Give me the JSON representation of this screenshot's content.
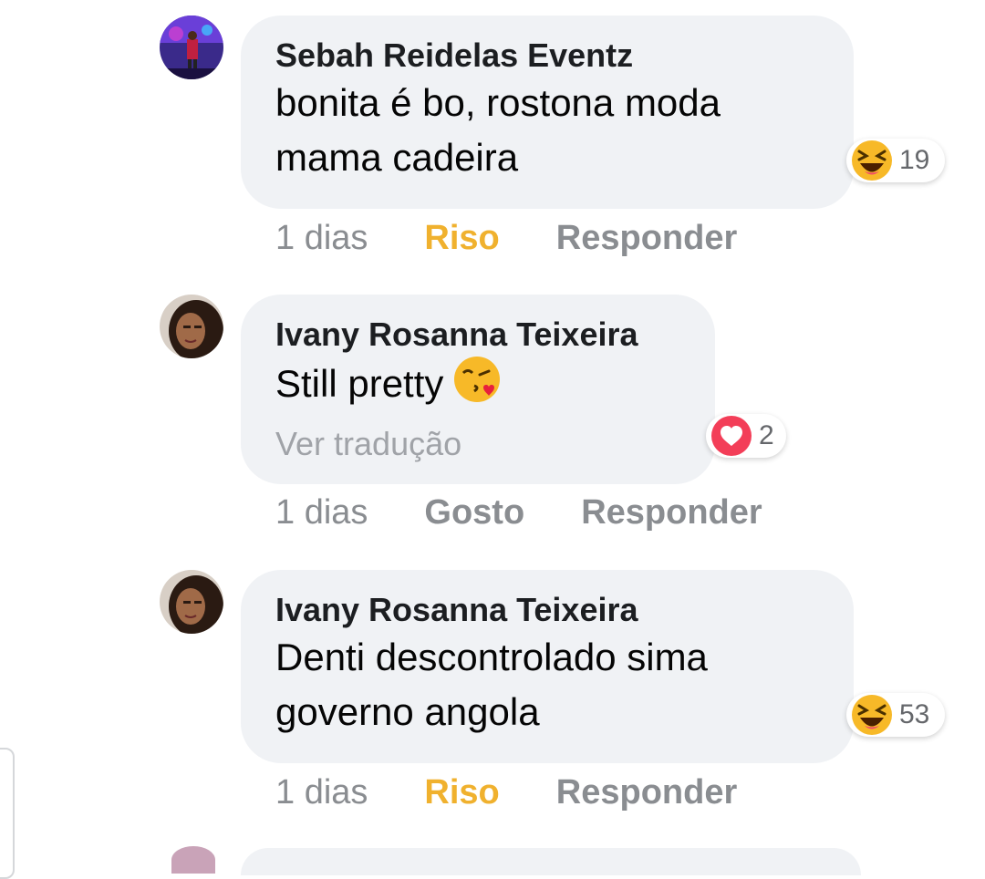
{
  "comments": [
    {
      "author": "Sebah Reidelas Eventz",
      "text": "bonita é bo, rostona moda mama cadeira",
      "translate": "",
      "reaction": {
        "icon": "laughing-emoji",
        "count": "19"
      },
      "actions": {
        "time": "1 dias",
        "react": "Riso",
        "reply": "Responder"
      }
    },
    {
      "author": "Ivany Rosanna Teixeira",
      "text": "Still pretty",
      "inline_emoji": "kiss-emoji",
      "translate": "Ver tradução",
      "reaction": {
        "icon": "heart",
        "count": "2"
      },
      "actions": {
        "time": "1 dias",
        "react": "Gosto",
        "reply": "Responder"
      }
    },
    {
      "author": "Ivany Rosanna Teixeira",
      "text": "Denti descontrolado sima governo angola",
      "translate": "",
      "reaction": {
        "icon": "laughing-emoji",
        "count": "53"
      },
      "actions": {
        "time": "1 dias",
        "react": "Riso",
        "reply": "Responder"
      }
    }
  ],
  "colors": {
    "bubble": "#f0f2f5",
    "riso": "#f0b12e",
    "action_gray": "#8a8d91",
    "heart_red": "#f33e58"
  }
}
